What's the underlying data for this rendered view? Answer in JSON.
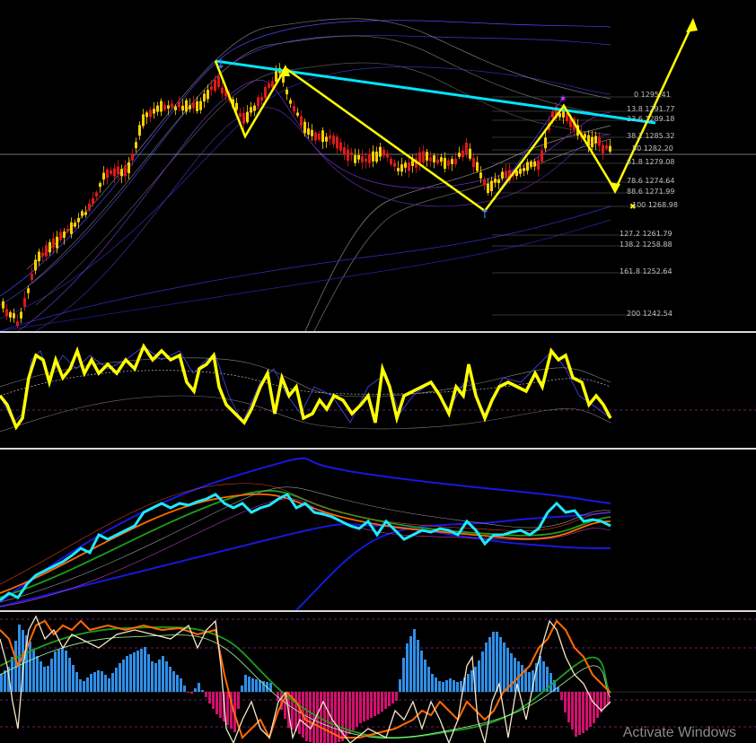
{
  "fib_levels": [
    {
      "ratio": "0",
      "price": "1295.41"
    },
    {
      "ratio": "13.8",
      "price": "1291.77"
    },
    {
      "ratio": "23.6",
      "price": "1289.18"
    },
    {
      "ratio": "38.2",
      "price": "1285.32"
    },
    {
      "ratio": "50",
      "price": "1282.20"
    },
    {
      "ratio": "61.8",
      "price": "1279.08"
    },
    {
      "ratio": "78.6",
      "price": "1274.64"
    },
    {
      "ratio": "88.6",
      "price": "1271.99"
    },
    {
      "ratio": "100",
      "price": "1268.98"
    },
    {
      "ratio": "127.2",
      "price": "1261.79"
    },
    {
      "ratio": "138.2",
      "price": "1258.88"
    },
    {
      "ratio": "161.8",
      "price": "1252.64"
    },
    {
      "ratio": "200",
      "price": "1242.54"
    }
  ],
  "watermark": "Activate Windows",
  "colors": {
    "background": "#000000",
    "pattern": "#ffff00",
    "trendline": "#00e5ff",
    "bull_candle": "#ffd000",
    "bear_candle": "#e01818",
    "hist_pos": "#2f8fe8",
    "hist_neg": "#d0106e"
  },
  "icons": {
    "pivot_marker": "fractal-arrow-icon",
    "target_marker": "cross-star-icon"
  }
}
